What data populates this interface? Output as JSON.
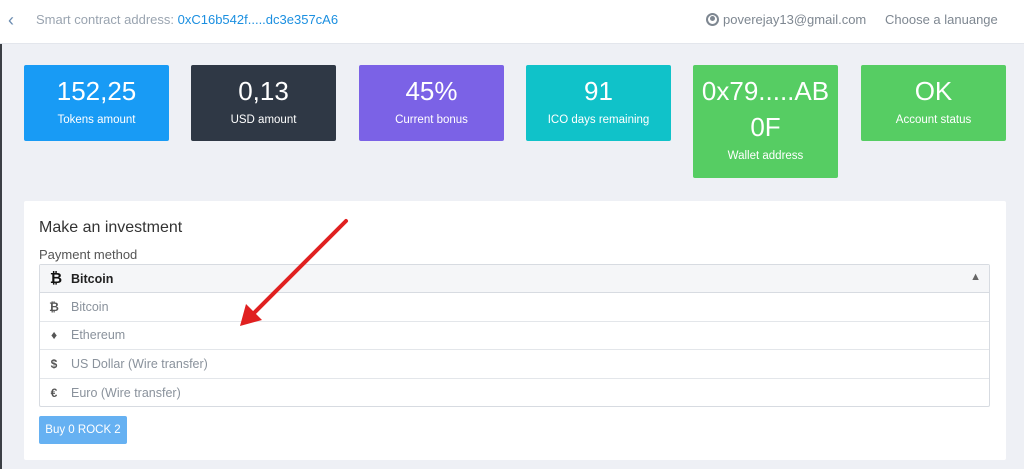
{
  "header": {
    "contract_label": "Smart contract address: ",
    "contract_address": "0xC16b542f.....dc3e357cA6",
    "user_email": "poverejay13@gmail.com",
    "language_label": "Choose a lanuange"
  },
  "stats": [
    {
      "value": "152,25",
      "label": "Tokens amount",
      "color": "#189bf5"
    },
    {
      "value": "0,13",
      "label": "USD amount",
      "color": "#2f3845"
    },
    {
      "value": "45%",
      "label": "Current bonus",
      "color": "#7b62e6"
    },
    {
      "value": "91",
      "label": "ICO days remaining",
      "color": "#10c2c9"
    },
    {
      "value": "0x79.....AB0F",
      "label": "Wallet address",
      "color": "#56cd63"
    },
    {
      "value": "OK",
      "label": "Account status",
      "color": "#56cd63"
    }
  ],
  "investment": {
    "title": "Make an investment",
    "payment_label": "Payment method",
    "selected": {
      "icon": "bitcoin-icon",
      "glyph": "₿",
      "label": "Bitcoin"
    },
    "options": [
      {
        "icon": "bitcoin-icon",
        "glyph": "₿",
        "label": "Bitcoin"
      },
      {
        "icon": "ethereum-icon",
        "glyph": "♦",
        "label": "Ethereum"
      },
      {
        "icon": "dollar-icon",
        "glyph": "$",
        "label": "US Dollar (Wire transfer)"
      },
      {
        "icon": "euro-icon",
        "glyph": "€",
        "label": "Euro (Wire transfer)"
      }
    ],
    "buy_label": "Buy 0 ROCK 2"
  },
  "annotation": {
    "arrow_color": "#e02020"
  }
}
